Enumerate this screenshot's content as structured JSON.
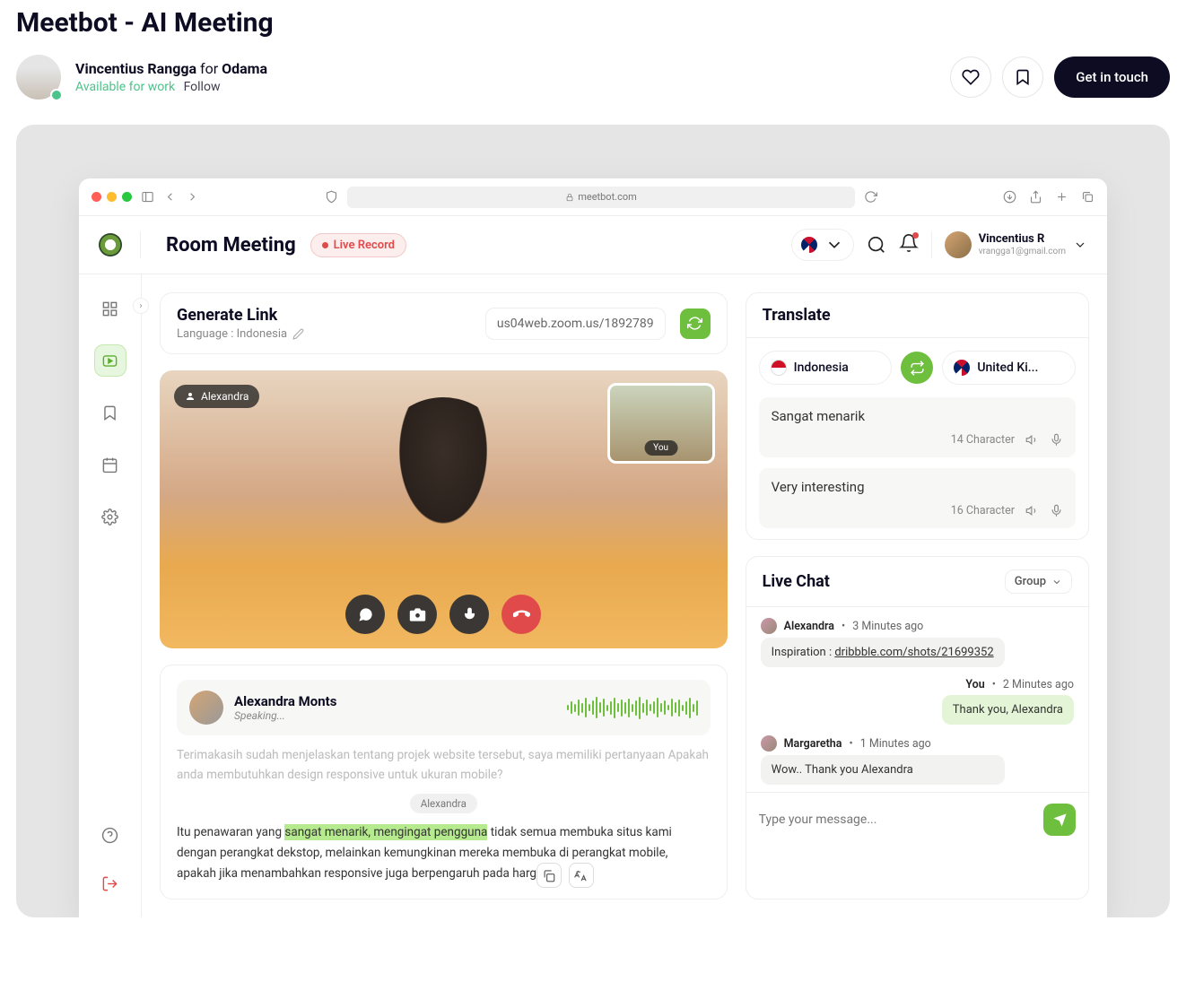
{
  "page": {
    "title": "Meetbot - AI Meeting"
  },
  "author": {
    "name": "Vincentius Rangga",
    "for": "for",
    "team": "Odama",
    "available": "Available for work",
    "follow": "Follow"
  },
  "actions": {
    "get_in_touch": "Get in touch"
  },
  "browser": {
    "url": "meetbot.com"
  },
  "appbar": {
    "title": "Room Meeting",
    "live": "Live Record",
    "user": {
      "name": "Vincentius R",
      "email": "vrangga1@gmail.com"
    }
  },
  "generate": {
    "title": "Generate Link",
    "language_label": "Language : Indonesia",
    "link": "us04web.zoom.us/1892789"
  },
  "video": {
    "peer": "Alexandra",
    "you": "You"
  },
  "transcript": {
    "speaker": "Alexandra Monts",
    "status": "Speaking...",
    "faded": "Terimakasih sudah menjelaskan tentang projek website tersebut, saya memiliki pertanyaan Apakah anda membutuhkan design responsive untuk ukuran mobile?",
    "chip": "Alexandra",
    "line_pre": "Itu penawaran yang ",
    "line_hl": "sangat menarik, mengingat pengguna",
    "line_post": " tidak semua membuka situs kami dengan perangkat dekstop, melainkan kemungkinan mereka membuka di perangkat mobile, apakah jika menambahkan responsive juga berpengaruh pada harga aw"
  },
  "translate": {
    "title": "Translate",
    "from": "Indonesia",
    "to": "United Ki...",
    "src": {
      "text": "Sangat menarik",
      "count": "14 Character"
    },
    "dst": {
      "text": "Very interesting",
      "count": "16 Character"
    }
  },
  "chat": {
    "title": "Live Chat",
    "scope": "Group",
    "messages": [
      {
        "name": "Alexandra",
        "time": "3 Minutes ago",
        "text_pre": "Inspiration : ",
        "link": "dribbble.com/shots/21699352"
      },
      {
        "name": "You",
        "time": "2 Minutes ago",
        "text": "Thank you, Alexandra"
      },
      {
        "name": "Margaretha",
        "time": "1 Minutes ago",
        "text": "Wow.. Thank you Alexandra"
      }
    ],
    "placeholder": "Type your message..."
  }
}
